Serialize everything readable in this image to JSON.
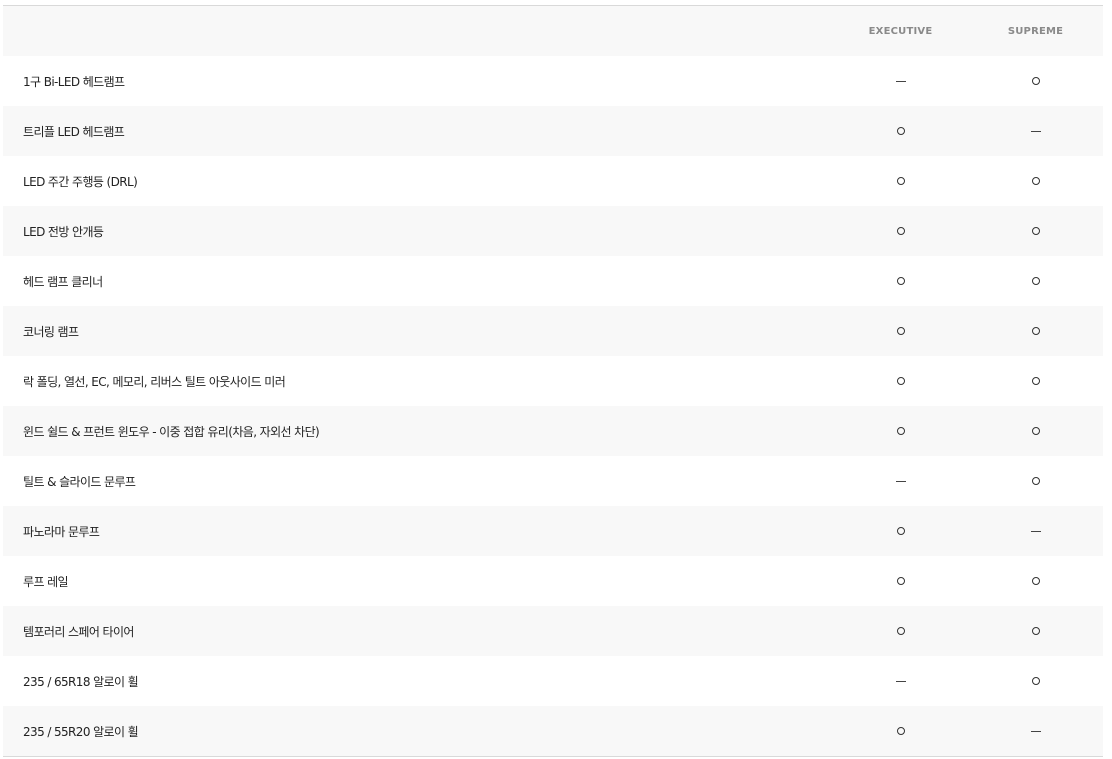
{
  "table": {
    "columns": [
      "EXECUTIVE",
      "SUPREME"
    ],
    "rows": [
      {
        "feature": "1구 Bi-LED 헤드램프",
        "executive": "—",
        "supreme": "○"
      },
      {
        "feature": "트리플 LED 헤드램프",
        "executive": "○",
        "supreme": "—"
      },
      {
        "feature": "LED 주간 주행등 (DRL)",
        "executive": "○",
        "supreme": "○"
      },
      {
        "feature": "LED 전방 안개등",
        "executive": "○",
        "supreme": "○"
      },
      {
        "feature": "헤드 램프 클리너",
        "executive": "○",
        "supreme": "○"
      },
      {
        "feature": "코너링 램프",
        "executive": "○",
        "supreme": "○"
      },
      {
        "feature": "락 폴딩, 열선, EC, 메모리, 리버스 틸트 아웃사이드 미러",
        "executive": "○",
        "supreme": "○"
      },
      {
        "feature": "윈드 쉴드 & 프런트 윈도우 - 이중 접합 유리(차음, 자외선 차단)",
        "executive": "○",
        "supreme": "○"
      },
      {
        "feature": "틸트 & 슬라이드 문루프",
        "executive": "—",
        "supreme": "○"
      },
      {
        "feature": "파노라마 문루프",
        "executive": "○",
        "supreme": "—"
      },
      {
        "feature": "루프 레일",
        "executive": "○",
        "supreme": "○"
      },
      {
        "feature": "템포러리 스페어 타이어",
        "executive": "○",
        "supreme": "○"
      },
      {
        "feature": "235 / 65R18 알로이 휠",
        "executive": "—",
        "supreme": "○"
      },
      {
        "feature": "235 / 55R20 알로이 휠",
        "executive": "○",
        "supreme": "—"
      }
    ]
  }
}
